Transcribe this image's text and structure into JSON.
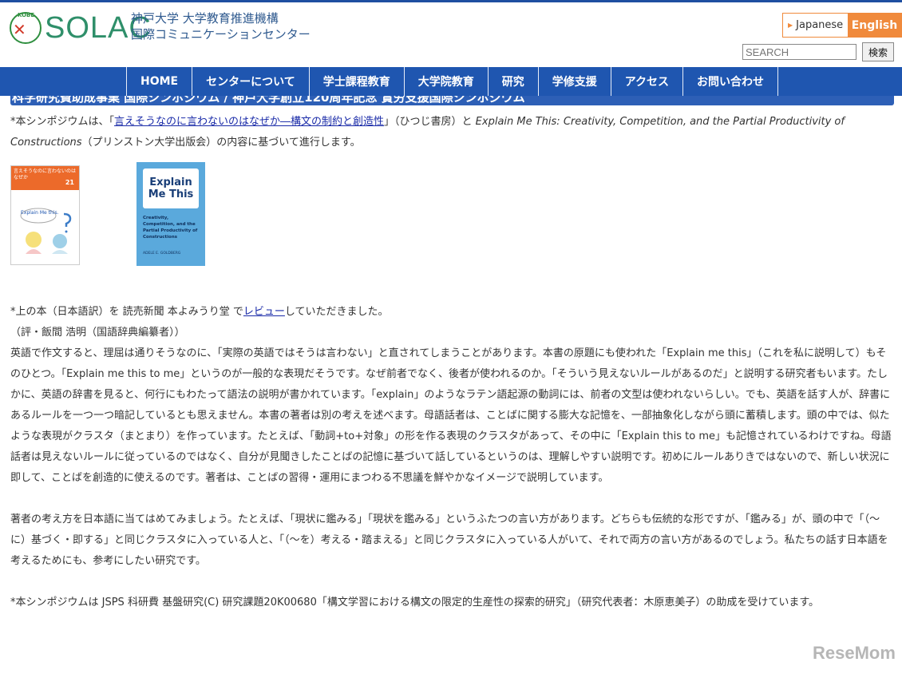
{
  "brand": {
    "kobe_mark": "KOBE",
    "name": "SOLAC",
    "subtitle_line1": "神戸大学 大学教育推進機構",
    "subtitle_line2": "国際コミュニケーションセンター"
  },
  "language": {
    "japanese": "Japanese",
    "english": "English"
  },
  "search": {
    "placeholder": "SEARCH",
    "button": "検索"
  },
  "nav": {
    "items": [
      {
        "label": "HOME"
      },
      {
        "label": "センターについて"
      },
      {
        "label": "学士課程教育"
      },
      {
        "label": "大学院教育"
      },
      {
        "label": "研究"
      },
      {
        "label": "学修支援"
      },
      {
        "label": "アクセス"
      },
      {
        "label": "お問い合わせ"
      }
    ]
  },
  "page": {
    "title_cut": "科学研究費助成事業 国際シンポジウム / 神戸大学創立120周年記念 賞労支援国際シンポジウム",
    "intro_prefix": "*本シンポジウムは、「",
    "intro_link": "言えそうなのに言わないのはなぜか―構文の制約と創造性",
    "intro_mid": "」（ひつじ書房）と ",
    "intro_book_en": "Explain Me This: Creativity, Competition, and the Partial Productivity of Constructions",
    "intro_suffix": "（プリンストン大学出版会）の内容に基づいて進行します。",
    "book1": {
      "band_text": "言えそうなのに言わないのはなぜか",
      "number": "21",
      "art_label": "Explain Me this."
    },
    "book2": {
      "title": "Explain Me This",
      "subtitle": "Creativity, Competition, and the Partial Productivity of Constructions",
      "author": "ADELE E. GOLDBERG"
    },
    "review_prefix": "*上の本（日本語訳）を 読売新聞 本よみうり堂 で",
    "review_link": "レビュー",
    "review_suffix": "していただきました。",
    "reviewer": "（評・飯間 浩明（国語辞典編纂者））",
    "para1": "英語で作文すると、理屈は通りそうなのに、「実際の英語ではそうは言わない」と直されてしまうことがあります。本書の原題にも使われた「Explain me this」（これを私に説明して）もそのひとつ。「Explain me this to me」というのが一般的な表現だそうです。なぜ前者でなく、後者が使われるのか。「そういう見えないルールがあるのだ」と説明する研究者もいます。たしかに、英語の辞書を見ると、何行にもわたって語法の説明が書かれています。「explain」のようなラテン語起源の動詞には、前者の文型は使われないらしい。でも、英語を話す人が、辞書にあるルールを一つ一つ暗記しているとも思えません。本書の著者は別の考えを述べます。母語話者は、ことばに関する膨大な記憶を、一部抽象化しながら頭に蓄積します。頭の中では、似たような表現がクラスタ（まとまり）を作っています。たとえば、「動詞+to+対象」の形を作る表現のクラスタがあって、その中に「Explain this to me」も記憶されているわけですね。母語話者は見えないルールに従っているのではなく、自分が見聞きしたことばの記憶に基づいて話しているというのは、理解しやすい説明です。初めにルールありきではないので、新しい状況に即して、ことばを創造的に使えるのです。著者は、ことばの習得・運用にまつわる不思議を鮮やかなイメージで説明しています。",
    "para2": "著者の考え方を日本語に当てはめてみましょう。たとえば、「現状に鑑みる」「現状を鑑みる」というふたつの言い方があります。どちらも伝統的な形ですが、「鑑みる」が、頭の中で「（～に）基づく・即する」と同じクラスタに入っている人と、「（～を）考える・踏まえる」と同じクラスタに入っている人がいて、それで両方の言い方があるのでしょう。私たちの話す日本語を考えるためにも、参考にしたい研究です。",
    "funding": "*本シンポジウムは JSPS 科研費 基盤研究(C) 研究課題20K00680「構文学習における構文の限定的生産性の探索的研究」（研究代表者：木原恵美子）の助成を受けています。"
  },
  "watermark": "ReseMom",
  "colors": {
    "nav": "#1f56b0",
    "accent": "#f08a3c",
    "link": "#1a2ba8"
  }
}
